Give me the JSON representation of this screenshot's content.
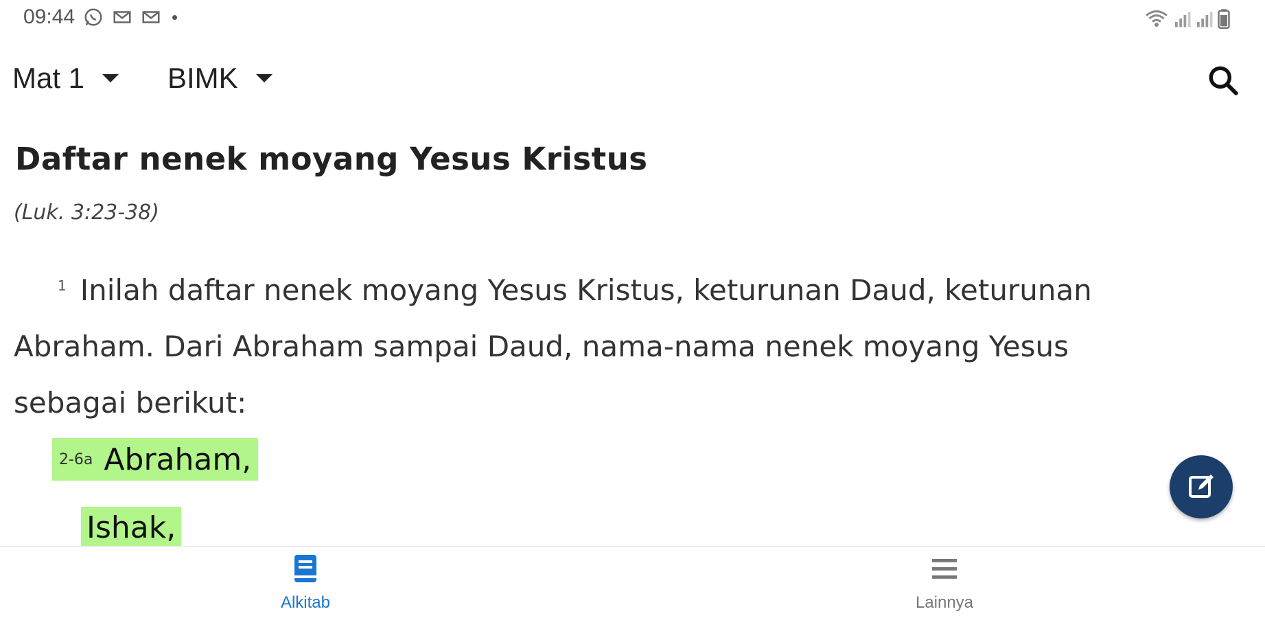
{
  "status_bar": {
    "time": "09:44",
    "icons": [
      "whatsapp-icon",
      "mail-icon",
      "mail-icon",
      "wifi-icon",
      "signal-icon",
      "signal-icon",
      "battery-icon"
    ]
  },
  "app_bar": {
    "book_selector": "Mat 1",
    "version_selector": "BIMK",
    "search_icon": "search-icon"
  },
  "content": {
    "heading": "Daftar nenek moyang Yesus Kristus",
    "cross_reference": "(Luk. 3:23-38)",
    "verse1_number": "1",
    "verse1_text": "Inilah daftar nenek moyang Yesus Kristus, keturunan Daud, keturunan Abraham. Dari Abraham sampai Daud, nama-nama nenek moyang Yesus sebagai berikut:",
    "verse2_number": "2-6a",
    "verse2_line1": "Abraham,",
    "verse2_line2": "Ishak,",
    "highlight_color": "#b2f58a"
  },
  "fab": {
    "icon": "edit-note-icon",
    "color": "#1c3e6a"
  },
  "bottom_nav": {
    "items": [
      {
        "label": "Alkitab",
        "icon": "book-icon",
        "active": true
      },
      {
        "label": "Lainnya",
        "icon": "menu-icon",
        "active": false
      }
    ],
    "active_color": "#1976d2"
  }
}
